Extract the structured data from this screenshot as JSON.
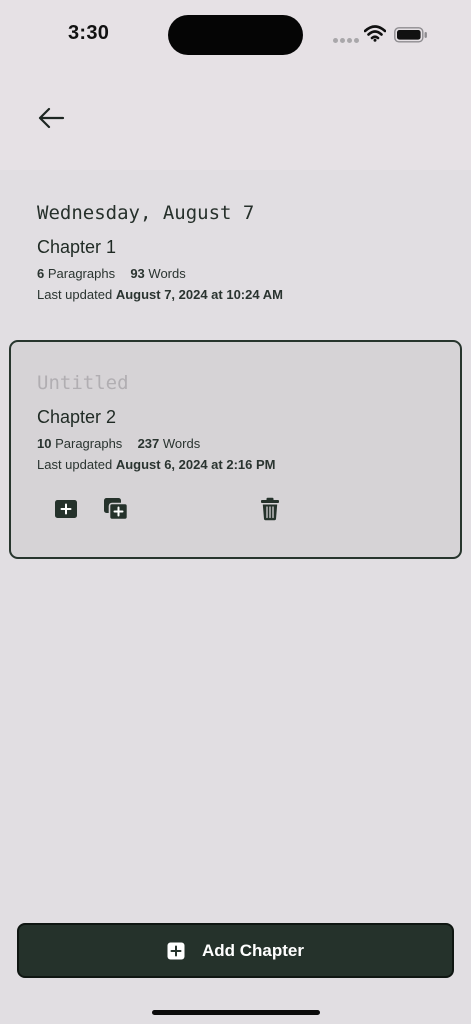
{
  "status_bar": {
    "time": "3:30",
    "icons": [
      "signal-icon",
      "wifi-icon",
      "battery-icon"
    ]
  },
  "header": {
    "back_icon": "arrow-left-icon"
  },
  "entries": [
    {
      "date_label": "Wednesday, August 7",
      "chapter": "Chapter 1",
      "paragraphs": "6",
      "paragraphs_label": "Paragraphs",
      "words": "93",
      "words_label": "Words",
      "updated_label": "Last updated",
      "updated_value": "August 7, 2024 at 10:24 AM",
      "selected": false
    },
    {
      "date_label": "Untitled",
      "chapter": "Chapter 2",
      "paragraphs": "10",
      "paragraphs_label": "Paragraphs",
      "words": "237",
      "words_label": "Words",
      "updated_label": "Last updated",
      "updated_value": "August 6, 2024 at 2:16 PM",
      "selected": true,
      "actions": [
        "add-paragraph-icon",
        "duplicate-icon",
        "trash-icon"
      ]
    }
  ],
  "footer": {
    "add_chapter_label": "Add Chapter",
    "add_icon": "plus-square-icon"
  },
  "colors": {
    "background": "#e1dee2",
    "header": "#e6e1e5",
    "accent_dark_green": "#25322b",
    "selected_card": "#d6d3d6",
    "placeholder_gray": "#b1aeb2"
  }
}
